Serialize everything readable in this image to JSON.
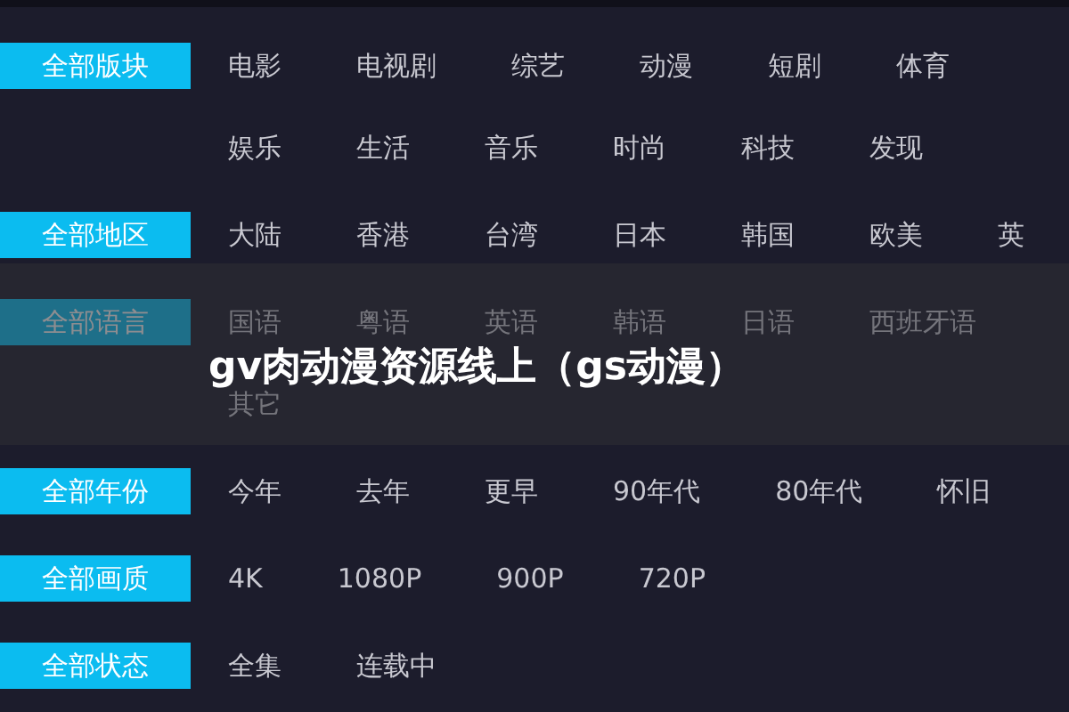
{
  "filters": [
    {
      "all": {
        "text": "全部版块",
        "selected": true
      },
      "lines": [
        [
          {
            "text": "电影",
            "selected": false
          },
          {
            "text": "电视剧",
            "selected": false
          },
          {
            "text": "综艺",
            "selected": false
          },
          {
            "text": "动漫",
            "selected": false
          },
          {
            "text": "短剧",
            "selected": false
          },
          {
            "text": "体育",
            "selected": false
          }
        ],
        [
          {
            "text": "娱乐",
            "selected": false
          },
          {
            "text": "生活",
            "selected": false
          },
          {
            "text": "音乐",
            "selected": false
          },
          {
            "text": "时尚",
            "selected": false
          },
          {
            "text": "科技",
            "selected": false
          },
          {
            "text": "发现",
            "selected": false
          }
        ]
      ]
    },
    {
      "all": {
        "text": "全部地区",
        "selected": true
      },
      "lines": [
        [
          {
            "text": "大陆",
            "selected": false
          },
          {
            "text": "香港",
            "selected": false
          },
          {
            "text": "台湾",
            "selected": false
          },
          {
            "text": "日本",
            "selected": false
          },
          {
            "text": "韩国",
            "selected": false
          },
          {
            "text": "欧美",
            "selected": false
          },
          {
            "text": "英",
            "selected": false
          }
        ]
      ]
    },
    {
      "all": {
        "text": "全部语言",
        "selected": true
      },
      "lines": [
        [
          {
            "text": "国语",
            "selected": false
          },
          {
            "text": "粤语",
            "selected": false
          },
          {
            "text": "英语",
            "selected": false
          },
          {
            "text": "韩语",
            "selected": false
          },
          {
            "text": "日语",
            "selected": false
          },
          {
            "text": "西班牙语",
            "selected": false
          }
        ],
        [
          {
            "text": "其它",
            "selected": false
          }
        ]
      ]
    },
    {
      "all": {
        "text": "全部年份",
        "selected": true
      },
      "lines": [
        [
          {
            "text": "今年",
            "selected": false
          },
          {
            "text": "去年",
            "selected": false
          },
          {
            "text": "更早",
            "selected": false
          },
          {
            "text": "90年代",
            "selected": false
          },
          {
            "text": "80年代",
            "selected": false
          },
          {
            "text": "怀旧",
            "selected": false
          }
        ]
      ]
    },
    {
      "all": {
        "text": "全部画质",
        "selected": true
      },
      "lines": [
        [
          {
            "text": "4K",
            "selected": false
          },
          {
            "text": "1080P",
            "selected": false
          },
          {
            "text": "900P",
            "selected": false
          },
          {
            "text": "720P",
            "selected": false
          }
        ]
      ]
    },
    {
      "all": {
        "text": "全部状态",
        "selected": true
      },
      "lines": [
        [
          {
            "text": "全集",
            "selected": false
          },
          {
            "text": "连载中",
            "selected": false
          }
        ]
      ]
    }
  ],
  "overlay_title": "gv肉动漫资源线上（gs动漫）"
}
